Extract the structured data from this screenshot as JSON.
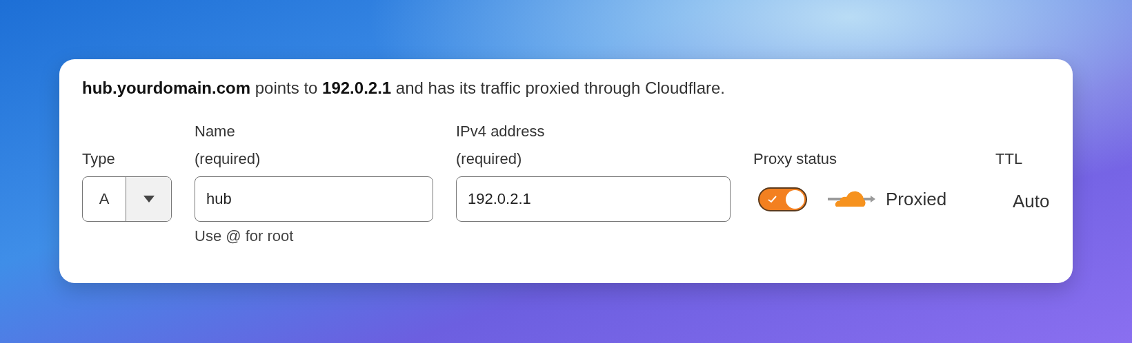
{
  "summary": "**hub.yourdomain.com** points to **192.0.2.1** and has its traffic proxied through Cloudflare.",
  "fields": [
    {
      "kind": "select",
      "label": "Type",
      "value": "A"
    },
    {
      "kind": "text",
      "label": "Name",
      "note": "(required)",
      "value": "hub",
      "hint": "Use @ for root"
    },
    {
      "kind": "text",
      "label": "IPv4 address",
      "note": "(required)",
      "value": "192.0.2.1"
    },
    {
      "kind": "proxy",
      "label": "Proxy status",
      "on": true,
      "status": "Proxied"
    },
    {
      "kind": "static",
      "label": "TTL",
      "value": "Auto"
    }
  ]
}
